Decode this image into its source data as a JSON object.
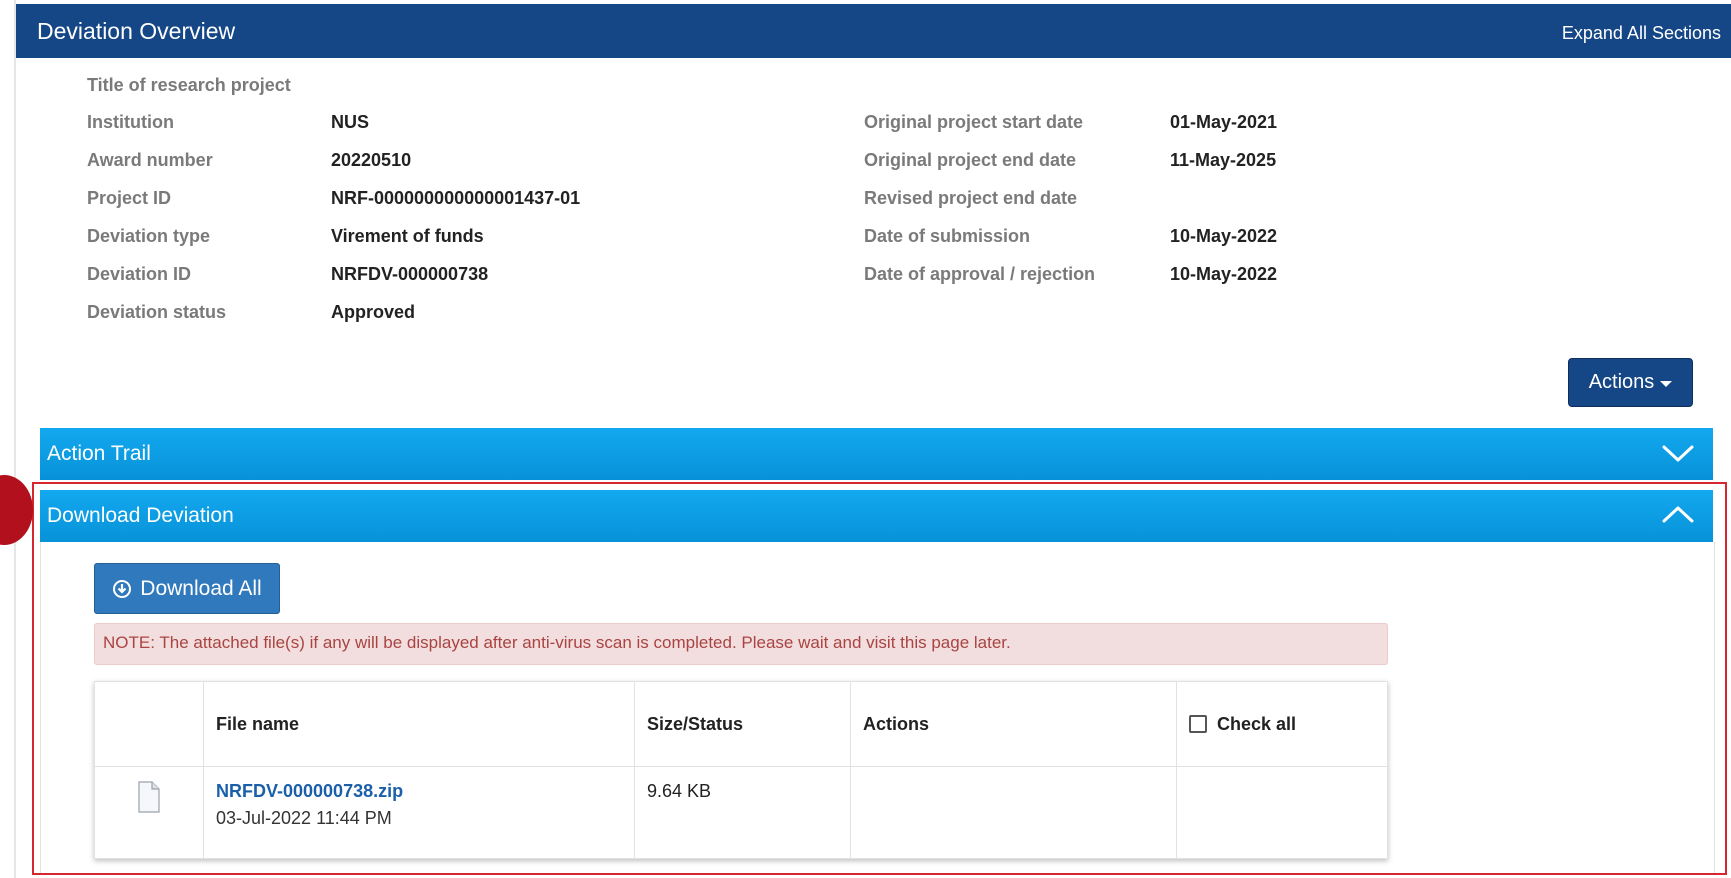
{
  "header": {
    "title": "Deviation Overview",
    "expand_all": "Expand All Sections"
  },
  "project": {
    "title_label": "Title of research project",
    "left": [
      {
        "label": "Institution",
        "value": "NUS"
      },
      {
        "label": "Award number",
        "value": "20220510"
      },
      {
        "label": "Project ID",
        "value": "NRF-000000000000001437-01"
      },
      {
        "label": "Deviation type",
        "value": "Virement of funds"
      },
      {
        "label": "Deviation ID",
        "value": "NRFDV-000000738"
      },
      {
        "label": "Deviation status",
        "value": "Approved"
      }
    ],
    "right": [
      {
        "label": "Original project start date",
        "value": "01-May-2021"
      },
      {
        "label": "Original project end date",
        "value": "11-May-2025"
      },
      {
        "label": "Revised project end date",
        "value": ""
      },
      {
        "label": "Date of submission",
        "value": "10-May-2022"
      },
      {
        "label": "Date of approval / rejection",
        "value": "10-May-2022"
      }
    ]
  },
  "actions_button": "Actions",
  "panels": {
    "action_trail": {
      "title": "Action Trail",
      "icon": "chevron-down-icon"
    },
    "download_deviation": {
      "title": "Download Deviation",
      "icon": "chevron-up-icon"
    }
  },
  "download": {
    "download_all": "Download All",
    "note": "NOTE: The attached file(s) if any will be displayed after anti-virus scan is completed. Please wait and visit this page later.",
    "columns": {
      "file_name": "File name",
      "size_status": "Size/Status",
      "actions": "Actions",
      "check_all": "Check all"
    },
    "files": [
      {
        "name": "NRFDV-000000738.zip",
        "date": "03-Jul-2022 11:44 PM",
        "size": "9.64 KB"
      }
    ]
  },
  "colors": {
    "header": "#154686",
    "panel": "#0a9de3",
    "highlight": "#d6262f",
    "note_bg": "#f2dede",
    "note_text": "#a94442",
    "link": "#1a5fa8"
  }
}
